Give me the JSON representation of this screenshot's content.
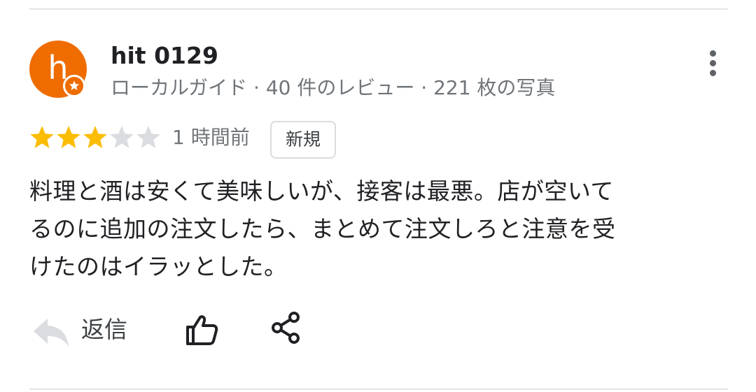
{
  "review": {
    "avatar_letter": "h",
    "reviewer_name": "hit 0129",
    "reviewer_meta": "ローカルガイド · 40 件のレビュー · 221 枚の写真",
    "rating": 3,
    "rating_max": 5,
    "time_ago": "1 時間前",
    "new_badge": "新規",
    "text_lines": [
      "料理と酒は安くて美味しいが、接客は最悪。店が空いて",
      "るのに追加の注文したら、まとめて注文しろと注意を受",
      "けたのはイラッとした。"
    ]
  },
  "actions": {
    "reply_label": "返信",
    "reply_icon": "reply-icon",
    "like_icon": "thumb-up-icon",
    "share_icon": "share-icon",
    "more_icon": "more-vert-icon"
  },
  "colors": {
    "avatar": "#ef6c00",
    "star_filled": "#fbbc04",
    "star_empty": "#dadce0",
    "secondary_text": "#70757a",
    "primary_text": "#202124"
  }
}
